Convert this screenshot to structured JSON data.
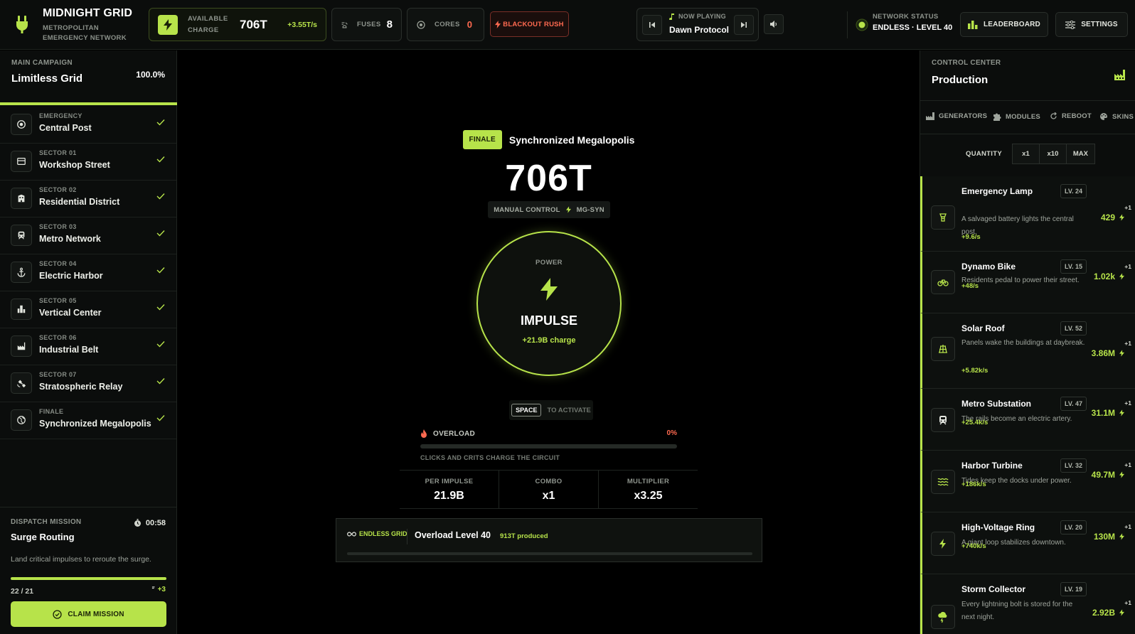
{
  "brand": {
    "title": "MIDNIGHT GRID",
    "subtitle": "METROPOLITAN EMERGENCY NETWORK"
  },
  "topbar": {
    "charge_label": "AVAILABLE CHARGE",
    "charge_value": "706T",
    "charge_rate": "+3.55T/s",
    "fuses_label": "FUSES",
    "fuses_value": "8",
    "cores_label": "CORES",
    "cores_value": "0",
    "blackout_label": "BLACKOUT RUSH",
    "now_playing_label": "NOW PLAYING",
    "track": "Dawn Protocol",
    "network_label": "NETWORK STATUS",
    "network_value": "ENDLESS · LEVEL 40",
    "leaderboard_label": "LEADERBOARD",
    "settings_label": "SETTINGS"
  },
  "campaign": {
    "label": "MAIN CAMPAIGN",
    "title": "Limitless Grid",
    "percent": "100.0%",
    "progress": 1.0
  },
  "sectors": [
    {
      "tag": "EMERGENCY",
      "name": "Central Post",
      "icon": "target-icon"
    },
    {
      "tag": "SECTOR 01",
      "name": "Workshop Street",
      "icon": "shop-icon"
    },
    {
      "tag": "SECTOR 02",
      "name": "Residential District",
      "icon": "building-icon"
    },
    {
      "tag": "SECTOR 03",
      "name": "Metro Network",
      "icon": "train-icon"
    },
    {
      "tag": "SECTOR 04",
      "name": "Electric Harbor",
      "icon": "anchor-icon"
    },
    {
      "tag": "SECTOR 05",
      "name": "Vertical Center",
      "icon": "tower-icon"
    },
    {
      "tag": "SECTOR 06",
      "name": "Industrial Belt",
      "icon": "factory-icon"
    },
    {
      "tag": "SECTOR 07",
      "name": "Stratospheric Relay",
      "icon": "satellite-icon"
    },
    {
      "tag": "FINALE",
      "name": "Synchronized Megalopolis",
      "icon": "globe-icon"
    }
  ],
  "dispatch": {
    "label": "DISPATCH MISSION",
    "timer": "00:58",
    "title": "Surge Routing",
    "desc": "Land critical impulses to reroute the surge.",
    "count": "22 / 21",
    "progress": 1.0,
    "reward": "+3",
    "claim_label": "CLAIM MISSION"
  },
  "center": {
    "finale_badge": "FINALE",
    "finale_title": "Synchronized Megalopolis",
    "big_charge": "706T",
    "manual_label": "MANUAL CONTROL",
    "manual_code": "MG-SYN",
    "power_label": "POWER",
    "impulse_label": "IMPULSE",
    "impulse_sub": "+21.9B charge",
    "space_key": "SPACE",
    "space_text": "TO ACTIVATE",
    "overload_label": "OVERLOAD",
    "overload_pct": "0%",
    "overload_level": 0,
    "overload_note": "CLICKS AND CRITS CHARGE THE CIRCUIT",
    "stats": [
      {
        "label": "PER IMPULSE",
        "value": "21.9B"
      },
      {
        "label": "COMBO",
        "value": "x1"
      },
      {
        "label": "MULTIPLIER",
        "value": "x3.25"
      }
    ],
    "endless_label": "ENDLESS GRID",
    "endless_title": "Overload Level 40",
    "endless_produced": "913T produced"
  },
  "control": {
    "label": "CONTROL CENTER",
    "title": "Production",
    "tabs": [
      "GENERATORS",
      "MODULES",
      "REBOOT",
      "SKINS"
    ],
    "quantity_label": "QUANTITY",
    "quantity_options": [
      "x1",
      "x10",
      "MAX"
    ]
  },
  "generators": [
    {
      "name": "Emergency Lamp",
      "level": "LV. 24",
      "desc": "A salvaged battery lights the central post.",
      "rate": "+9.6/s",
      "cost": "429",
      "plus": "+1",
      "icon": "lamp-icon"
    },
    {
      "name": "Dynamo Bike",
      "level": "LV. 15",
      "desc": "Residents pedal to power their street.",
      "rate": "+48/s",
      "cost": "1.02k",
      "plus": "+1",
      "icon": "bike-icon"
    },
    {
      "name": "Solar Roof",
      "level": "LV. 52",
      "desc": "Panels wake the buildings at daybreak.",
      "rate": "+5.82k/s",
      "cost": "3.86M",
      "plus": "+1",
      "icon": "solar-icon"
    },
    {
      "name": "Metro Substation",
      "level": "LV. 47",
      "desc": "The rails become an electric artery.",
      "rate": "+25.4k/s",
      "cost": "31.1M",
      "plus": "+1",
      "icon": "train-icon"
    },
    {
      "name": "Harbor Turbine",
      "level": "LV. 32",
      "desc": "Tides keep the docks under power.",
      "rate": "+186k/s",
      "cost": "49.7M",
      "plus": "+1",
      "icon": "waves-icon"
    },
    {
      "name": "High-Voltage Ring",
      "level": "LV. 20",
      "desc": "A giant loop stabilizes downtown.",
      "rate": "+740k/s",
      "cost": "130M",
      "plus": "+1",
      "icon": "bolt-icon"
    },
    {
      "name": "Storm Collector",
      "level": "LV. 19",
      "desc": "Every lightning bolt is stored for the next night.",
      "rate": "",
      "cost": "2.92B",
      "plus": "+1",
      "icon": "storm-icon"
    }
  ]
}
